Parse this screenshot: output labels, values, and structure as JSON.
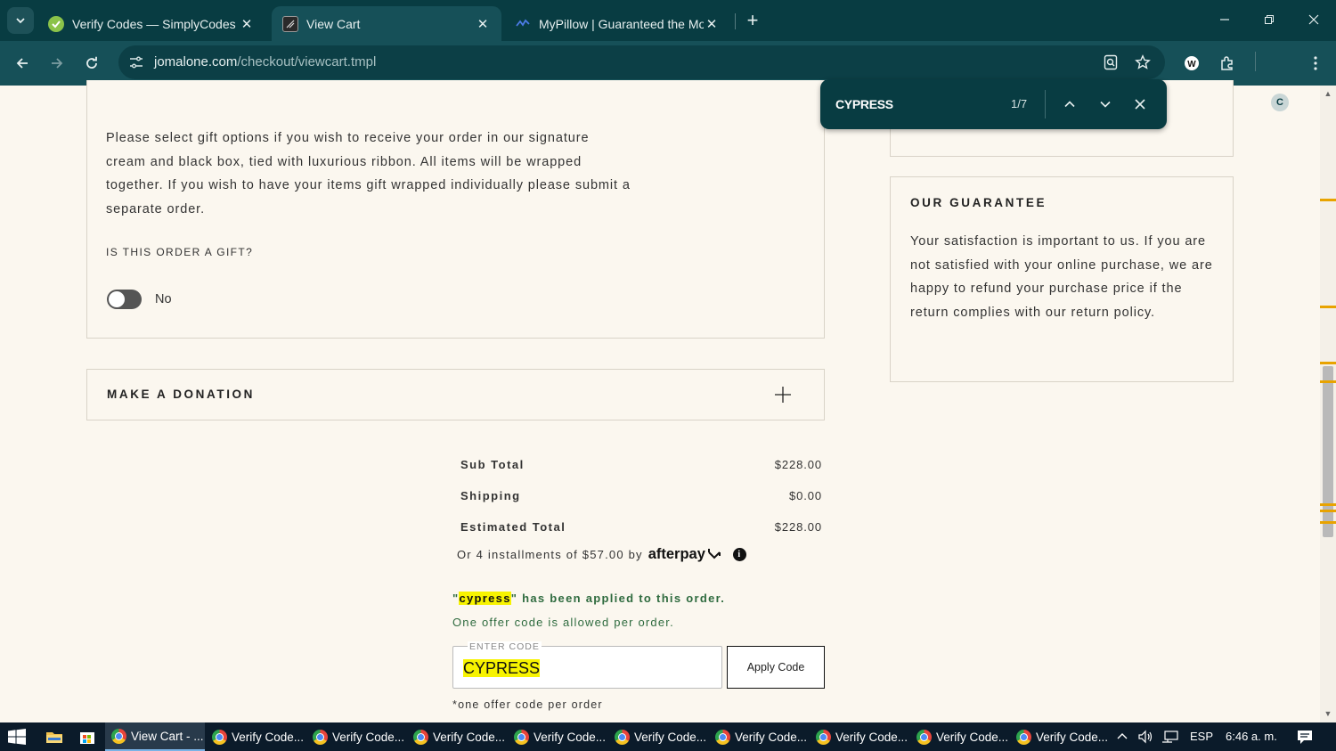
{
  "browser": {
    "tabs": [
      {
        "title": "Verify Codes — SimplyCodes",
        "icon": "simplycodes-icon",
        "active": false
      },
      {
        "title": "View Cart",
        "icon": "jomalone-icon",
        "active": true
      },
      {
        "title": "MyPillow | Guaranteed the Most",
        "icon": "mypillow-icon",
        "active": false
      }
    ],
    "url_host": "jomalone.com",
    "url_path": "/checkout/viewcart.tmpl",
    "find_query": "CYPRESS",
    "find_count": "1/7",
    "profile_initial": "C"
  },
  "gift": {
    "description": "Please select gift options if you wish to receive your order in our signature cream and black box, tied with luxurious ribbon. All items will be wrapped together. If you wish to have your items gift wrapped individually please submit a separate order.",
    "question": "IS THIS ORDER A GIFT?",
    "toggle_label": "No",
    "toggle_on": false
  },
  "donation": {
    "title": "MAKE A DONATION"
  },
  "summary": {
    "rows": [
      {
        "label": "Sub Total",
        "value": "$228.00"
      },
      {
        "label": "Shipping",
        "value": "$0.00"
      },
      {
        "label": "Estimated Total",
        "value": "$228.00"
      }
    ],
    "afterpay_text": "Or 4 installments of $57.00 by",
    "afterpay_brand": "afterpay"
  },
  "offer": {
    "applied_open": "\"",
    "applied_code": "cypress",
    "applied_rest": "\" has been applied to this order.",
    "note": "One offer code is allowed per order.",
    "field_label": "ENTER CODE",
    "field_value": "CYPRESS",
    "apply_label": "Apply Code",
    "footnote": "*one offer code per order"
  },
  "guarantee": {
    "title": "OUR GUARANTEE",
    "text": "Your satisfaction is important to us. If you are not satisfied with your online purchase, we are happy to refund your purchase price if the return complies with our return policy."
  },
  "taskbar": {
    "apps": [
      {
        "label": "View Cart - ...",
        "active": true
      },
      {
        "label": "Verify Code...",
        "active": false
      },
      {
        "label": "Verify Code...",
        "active": false
      },
      {
        "label": "Verify Code...",
        "active": false
      },
      {
        "label": "Verify Code...",
        "active": false
      },
      {
        "label": "Verify Code...",
        "active": false
      },
      {
        "label": "Verify Code...",
        "active": false
      },
      {
        "label": "Verify Code...",
        "active": false
      },
      {
        "label": "Verify Code...",
        "active": false
      },
      {
        "label": "Verify Code...",
        "active": false
      }
    ],
    "language": "ESP",
    "time": "6:46 a. m."
  },
  "colors": {
    "chrome_dark": "#083c42",
    "chrome_toolbar": "#165058",
    "page_bg": "#fbf7ef",
    "highlight": "#f7f300",
    "success_text": "#2f6b3f"
  }
}
